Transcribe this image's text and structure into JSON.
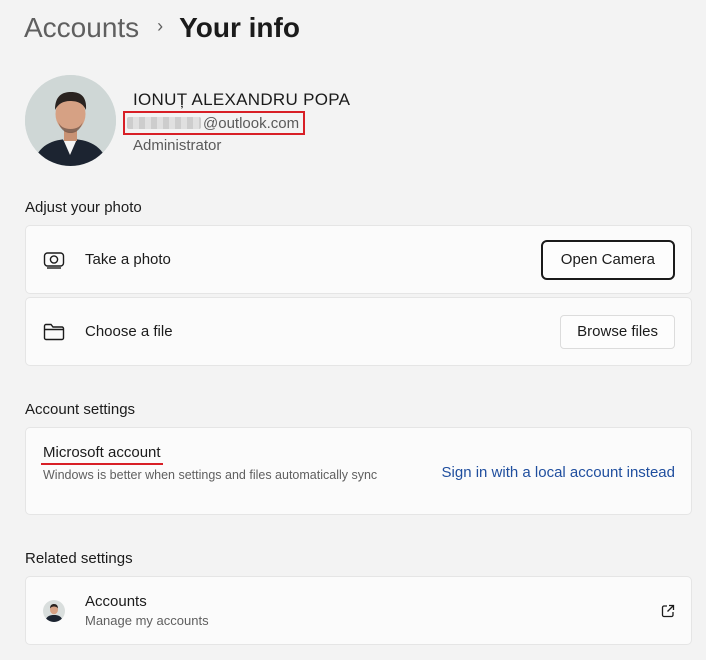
{
  "header": {
    "parent": "Accounts",
    "separator": "›",
    "current": "Your info"
  },
  "profile": {
    "name": "IONUȚ ALEXANDRU POPA",
    "email_domain": "@outlook.com",
    "role": "Administrator"
  },
  "adjust_photo": {
    "title": "Adjust your photo",
    "take_photo_label": "Take a photo",
    "open_camera_label": "Open Camera",
    "choose_file_label": "Choose a file",
    "browse_files_label": "Browse files"
  },
  "account_settings": {
    "title": "Account settings",
    "microsoft_account": "Microsoft account",
    "description": "Windows is better when settings and files automatically sync",
    "local_account_link": "Sign in with a local account instead"
  },
  "related_settings": {
    "title": "Related settings",
    "accounts_title": "Accounts",
    "accounts_subtitle": "Manage my accounts"
  },
  "colors": {
    "background": "#f3f3f3",
    "card": "#fbfbfb",
    "highlight": "#d81f26",
    "link": "#1f4e9e"
  }
}
